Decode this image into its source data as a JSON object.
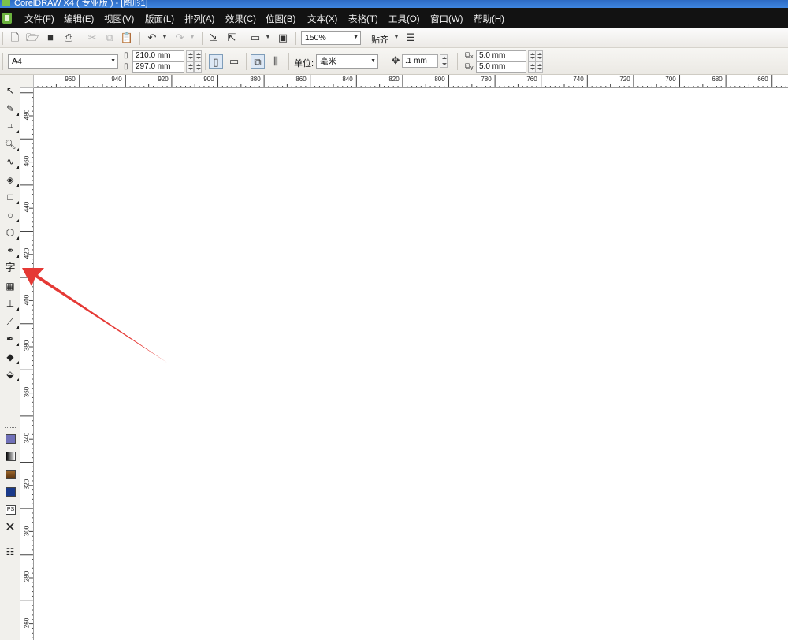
{
  "window": {
    "title": "CorelDRAW X4 ( 专业版 ) - [图形1]"
  },
  "menu": {
    "items": [
      "文件(F)",
      "编辑(E)",
      "视图(V)",
      "版面(L)",
      "排列(A)",
      "效果(C)",
      "位图(B)",
      "文本(X)",
      "表格(T)",
      "工具(O)",
      "窗口(W)",
      "帮助(H)"
    ]
  },
  "standard_toolbar": {
    "zoom_level": "150%",
    "snap_label": "贴齐",
    "icons": [
      "new-icon",
      "open-icon",
      "save-icon",
      "print-icon",
      "cut-icon",
      "copy-icon",
      "paste-icon",
      "undo-icon",
      "redo-icon",
      "import-icon",
      "export-icon",
      "application-launcher-icon",
      "welcome-screen-icon",
      "options-icon"
    ]
  },
  "property_bar": {
    "paper_size": "A4",
    "width": "210.0 mm",
    "height": "297.0 mm",
    "units_label": "单位:",
    "units_value": "毫米",
    "nudge": ".1 mm",
    "duplicate_x": "5.0 mm",
    "duplicate_y": "5.0 mm"
  },
  "rulers": {
    "horizontal": [
      "960",
      "940",
      "920",
      "900",
      "880",
      "860",
      "840",
      "820",
      "800",
      "780",
      "760",
      "740",
      "720",
      "700",
      "680",
      "660"
    ],
    "vertical": [
      "480",
      "460",
      "440",
      "420",
      "400",
      "380",
      "360",
      "340",
      "320",
      "300",
      "280",
      "260"
    ]
  },
  "toolbox": {
    "tools": [
      "pick-tool",
      "shape-tool",
      "crop-tool",
      "zoom-tool",
      "freehand-tool",
      "smart-fill-tool",
      "rectangle-tool",
      "ellipse-tool",
      "polygon-tool",
      "basic-shapes-tool",
      "text-tool",
      "table-tool",
      "dimension-tool",
      "eyedropper-tool",
      "outline-tool",
      "fill-tool",
      "interactive-fill-tool"
    ],
    "text_tool_glyph": "字",
    "colors": {
      "purple_swatch": "#7070b8",
      "gradient_start": "#000000",
      "gradient_end": "#ffffff",
      "texture": "#7a4a1a",
      "pattern": "#1a3a8a"
    }
  },
  "annotation": {
    "arrow_color": "#e53935",
    "points_to": "text-tool"
  }
}
